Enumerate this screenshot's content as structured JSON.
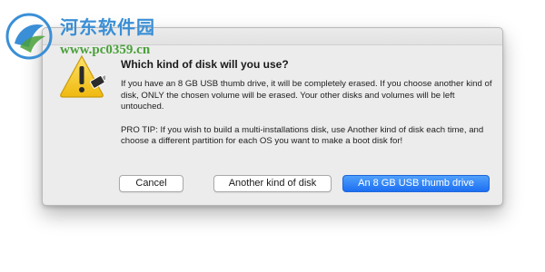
{
  "watermark": {
    "title": "河东软件园",
    "url": "www.pc0359.cn"
  },
  "dialog": {
    "title": "Which kind of disk will you use?",
    "paragraph1": "If you have an 8 GB USB thumb drive, it will be completely erased. If you choose another kind of disk, ONLY the chosen volume will be erased. Your other disks and volumes will be left untouched.",
    "paragraph2": "PRO TIP: If you wish to build a multi-installations disk, use Another kind of disk each time, and choose a different partition for each OS you want to make a boot disk for!",
    "icon": "warning-triangle-usb-icon",
    "buttons": {
      "cancel": "Cancel",
      "another": "Another kind of disk",
      "usb": "An 8 GB USB thumb drive"
    }
  },
  "colors": {
    "primary_button": "#1d6ff2",
    "dialog_background": "#ececec",
    "warning_yellow": "#f2c21a"
  }
}
